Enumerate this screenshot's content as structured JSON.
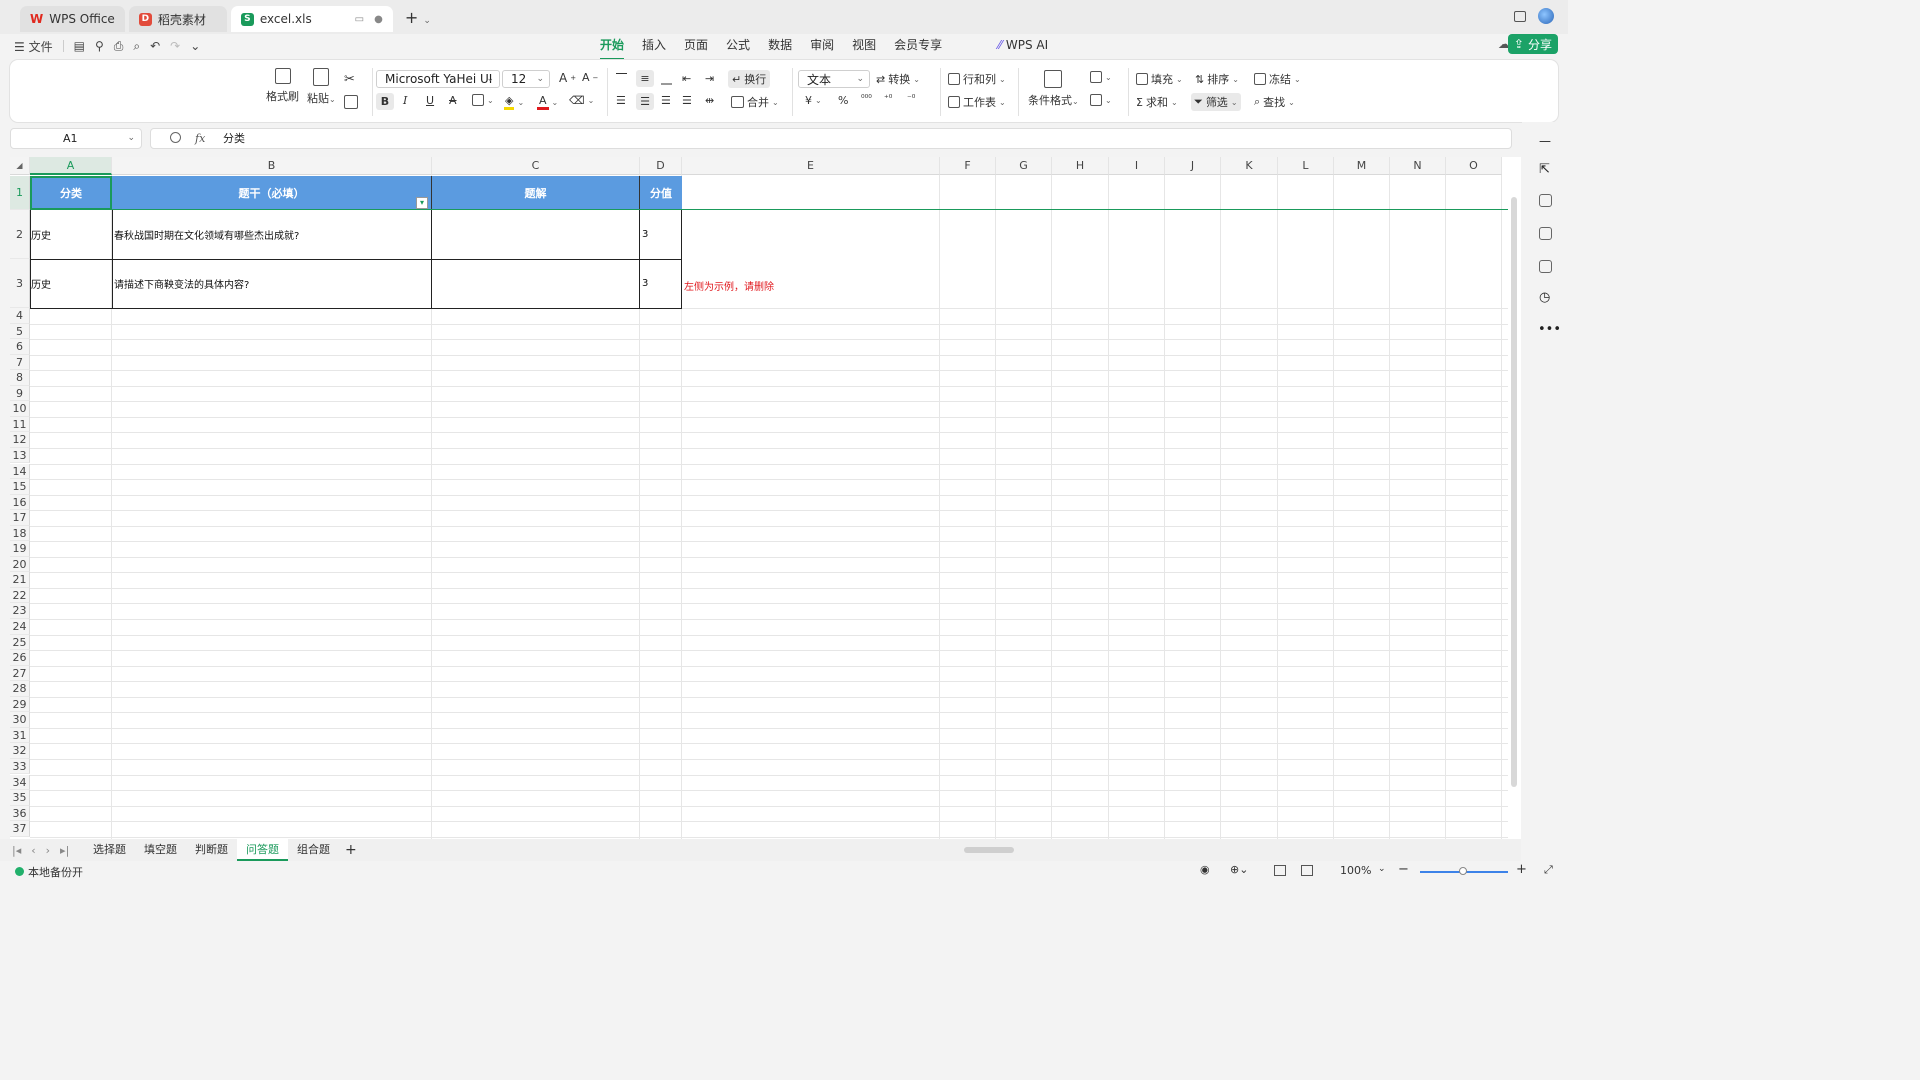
{
  "tabs": [
    {
      "label": "WPS Office",
      "icon": "wps-logo-icon",
      "color": "#e0291e"
    },
    {
      "label": "稻壳素材",
      "icon": "daoke-icon",
      "color": "#e24b3b"
    },
    {
      "label": "excel.xls",
      "icon": "spreadsheet-s-icon",
      "color": "#1a9a5b"
    }
  ],
  "menubar": {
    "file_label": "文件",
    "tabs": [
      "开始",
      "插入",
      "页面",
      "公式",
      "数据",
      "审阅",
      "视图",
      "会员专享"
    ],
    "active_tab": "开始",
    "wps_ai": "WPS AI",
    "share": "分享"
  },
  "ribbon": {
    "format_painter": "格式刷",
    "paste": "粘贴",
    "font_name": "Microsoft YaHei UI",
    "font_size": "12",
    "wrap": "换行",
    "merge": "合并",
    "number_format": "文本",
    "convert": "转换",
    "rows_cols": "行和列",
    "worksheet": "工作表",
    "cond_format": "条件格式",
    "fill": "填充",
    "sort": "排序",
    "freeze": "冻结",
    "sum": "求和",
    "filter": "筛选",
    "find": "查找",
    "currency_symbol": "¥",
    "percent_symbol": "%"
  },
  "formula": {
    "cell_ref": "A1",
    "fx": "fx",
    "value": "分类"
  },
  "columns": [
    "A",
    "B",
    "C",
    "D",
    "E",
    "F",
    "G",
    "H",
    "I",
    "J",
    "K",
    "L",
    "M",
    "N",
    "O"
  ],
  "selected_column": "A",
  "table": {
    "headers": [
      "分类",
      "题干（必填）",
      "题解",
      "分值"
    ],
    "rows": [
      [
        "历史",
        "春秋战国时期在文化领域有哪些杰出成就?",
        "",
        "3"
      ],
      [
        "历史",
        "请描述下商鞅变法的具体内容?",
        "",
        "3"
      ]
    ],
    "note": "左侧为示例，请删除",
    "header_color": "#5b9be0"
  },
  "row_numbers": [
    "1",
    "2",
    "3",
    "4",
    "5",
    "6",
    "7",
    "8",
    "9",
    "10",
    "11",
    "12",
    "13",
    "14",
    "15",
    "16",
    "17",
    "18",
    "19",
    "20",
    "21",
    "22",
    "23",
    "24",
    "25",
    "26",
    "27",
    "28",
    "29",
    "30",
    "31",
    "32",
    "33",
    "34",
    "35",
    "36",
    "37"
  ],
  "sheets": [
    "选择题",
    "填空题",
    "判断题",
    "问答题",
    "组合题"
  ],
  "active_sheet": "问答题",
  "status": {
    "backup": "本地备份开",
    "zoom": "100%"
  },
  "accent_color": "#1a9a5b"
}
